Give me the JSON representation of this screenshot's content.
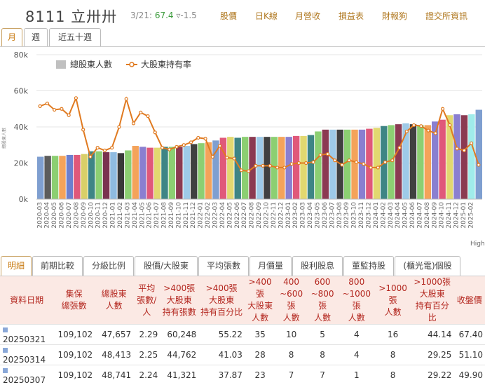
{
  "header": {
    "stock_code": "8111 立卅卅",
    "quote_date": "3/21:",
    "quote_price": "67.4",
    "quote_change": "▿-1.5",
    "nav": [
      "股價",
      "日K線",
      "月營收",
      "損益表",
      "財報狗",
      "證交所資訊"
    ]
  },
  "period_tabs": [
    "月",
    "週",
    "近五十週"
  ],
  "chart_data": {
    "type": "bar",
    "legend": [
      "總股東人數",
      "大股東持有率"
    ],
    "legend_position": "top-left",
    "y_ticks": [
      "0k",
      "20k",
      "40k",
      "60k",
      "80k"
    ],
    "ylim": [
      0,
      80000
    ],
    "y2lim": [
      0,
      80
    ],
    "ylabel": "總股東人數",
    "overflow_label": "High",
    "x_tick_labels": [
      "2020-03",
      "2020-04",
      "2020-05",
      "2020-06",
      "2020-07",
      "2020-08",
      "2020-09",
      "2020-10",
      "2020-11",
      "2020-12",
      "2021-01",
      "2021-02",
      "2021-03",
      "2021-04",
      "2021-05",
      "2021-06",
      "2021-07",
      "2021-08",
      "2021-09",
      "2021-10",
      "2021-11",
      "2021-12",
      "2022-01",
      "2022-02",
      "2022-03",
      "2022-04",
      "2022-05",
      "2022-06",
      "2022-07",
      "2022-08",
      "2022-09",
      "2022-10",
      "2022-11",
      "2022-12",
      "2023-01",
      "2023-02",
      "2023-03",
      "2023-04",
      "2023-05",
      "2023-06",
      "2023-07",
      "2023-08",
      "2023-09",
      "2023-10",
      "2023-11",
      "2023-12",
      "2024-01",
      "2024-02",
      "2024-03",
      "2024-04",
      "2024-05",
      "2024-06",
      "2024-07",
      "2024-08",
      "2024-09",
      "2024-10",
      "2024-11",
      "2024-12",
      "2025-01",
      "2025-02"
    ],
    "bar_values": [
      23500,
      24000,
      24000,
      24000,
      24500,
      24500,
      25000,
      26500,
      26500,
      26000,
      26000,
      25500,
      27000,
      29500,
      29000,
      28500,
      28500,
      29000,
      29000,
      29000,
      29500,
      30500,
      31000,
      31500,
      32500,
      34000,
      34500,
      34000,
      34500,
      34500,
      34500,
      34500,
      34500,
      34500,
      34500,
      35000,
      35000,
      35500,
      37500,
      38500,
      38500,
      38500,
      38500,
      38500,
      38500,
      39000,
      39500,
      40500,
      41000,
      41500,
      42000,
      41500,
      41000,
      41000,
      43000,
      44000,
      46500,
      47000,
      46500,
      47000,
      49500
    ],
    "line_values": [
      51.5,
      53,
      49.5,
      50,
      46.5,
      56,
      38.5,
      23.5,
      28.5,
      27,
      28.5,
      40,
      55.5,
      42,
      48,
      46,
      37,
      28.5,
      27.5,
      29,
      30,
      31.5,
      34,
      33.5,
      23.5,
      29.5,
      23,
      22.5,
      16,
      15.5,
      18.5,
      18.5,
      18.5,
      17.5,
      17.5,
      19.5,
      20,
      20,
      20.5,
      24.5,
      25,
      21.5,
      19,
      21.5,
      20.5,
      19.5,
      17.5,
      17.5,
      20.5,
      21.5,
      28.5,
      37.5,
      41,
      40.5,
      38,
      36.5,
      50,
      41,
      28,
      27,
      31,
      19
    ],
    "colors": [
      "#7f9fd0",
      "#5c5c5c",
      "#8ccf72",
      "#f4a35a",
      "#6c7fce",
      "#e0587a",
      "#d9cf68",
      "#3e8585",
      "#8ccf72",
      "#7a3350",
      "#8fbbe0",
      "#393939",
      "#8ccf72",
      "#f4a35a",
      "#8a7fd0",
      "#e0587a",
      "#e2d870",
      "#3e8585",
      "#8ccf72",
      "#8b3a52",
      "#9ecae8",
      "#404040",
      "#8ccf72",
      "#f4a35a",
      "#7f9fd0",
      "#e0587a",
      "#e2d870",
      "#3e8585",
      "#8ccf72",
      "#8b3a52",
      "#9ecae8",
      "#404040",
      "#8ccf72",
      "#f4a35a",
      "#8a7fd0",
      "#e0587a",
      "#e2d870",
      "#3e8585",
      "#8ccf72",
      "#8b3a52",
      "#9ecae8",
      "#404040",
      "#8ccf72",
      "#f4a35a",
      "#8a7fd0",
      "#e0587a",
      "#e2d870",
      "#3e8585",
      "#8ccf72",
      "#8b3a52",
      "#9ecae8",
      "#404040",
      "#8ccf72",
      "#f4a35a",
      "#8a7fd0",
      "#e0587a",
      "#e2d870",
      "#8a7fd0",
      "#8b3a52",
      "#a0ecea"
    ],
    "bar_legend_color": "#c0c0c0",
    "line_color": "#e07a20"
  },
  "detail_tabs": [
    "明細",
    "前期比較",
    "分級比例",
    "股價/大股東",
    "平均張數",
    "月價量",
    "股利股息",
    "董監持股",
    "(櫃光電)個股"
  ],
  "table": {
    "headers": [
      [
        "資料日期"
      ],
      [
        "集保",
        "總張數"
      ],
      [
        "總股東",
        "人數"
      ],
      [
        "平均",
        "張數/人"
      ],
      [
        ">400張",
        "大股東",
        "持有張數"
      ],
      [
        ">400張",
        "大股東",
        "持有百分比"
      ],
      [
        ">400張",
        "大股東",
        "人數"
      ],
      [
        "400",
        "~600張",
        "人數"
      ],
      [
        "600",
        "~800張",
        "人數"
      ],
      [
        "800",
        "~1000張",
        "人數"
      ],
      [
        ">1000張",
        "人數"
      ],
      [
        ">1000張",
        "大股東",
        "持有百分比"
      ],
      [
        "收盤價"
      ]
    ],
    "rows": [
      [
        "20250321",
        "109,102",
        "47,657",
        "2.29",
        "60,248",
        "55.22",
        "35",
        "10",
        "5",
        "4",
        "16",
        "44.14",
        "67.40"
      ],
      [
        "20250314",
        "109,102",
        "48,413",
        "2.25",
        "44,762",
        "41.03",
        "28",
        "8",
        "8",
        "4",
        "8",
        "29.25",
        "51.10"
      ],
      [
        "20250307",
        "109,102",
        "48,741",
        "2.24",
        "41,321",
        "37.87",
        "23",
        "7",
        "7",
        "1",
        "8",
        "29.22",
        "49.90"
      ]
    ]
  }
}
